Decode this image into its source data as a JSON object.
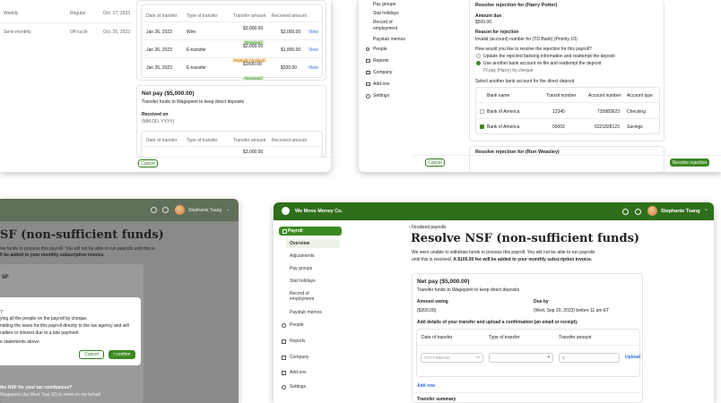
{
  "colors": {
    "brand_green": "#2f6f1c",
    "accent_green": "#3c8a22",
    "link_blue": "#2a6fdb"
  },
  "panel1": {
    "history_rows": [
      {
        "period": "Weekly",
        "type": "Regular",
        "date": "Oct. 17, 2023"
      },
      {
        "period": "Semi-monthly",
        "type": "Off-cycle",
        "date": "Oct. 25, 2023"
      }
    ],
    "transfer_headers": [
      "Date of transfer",
      "Type of transfer",
      "Transfer amount",
      "Received amount"
    ],
    "transfer_rows": [
      {
        "date": "Jan 26, 2023",
        "type": "Wire",
        "amount": "$3,000.00",
        "status": "Received",
        "received": "$3,000.00",
        "action": "View"
      },
      {
        "date": "Jan 26, 2023",
        "type": "E-transfer",
        "amount": "$2,000.00",
        "status": "Partially received",
        "received": "$1,800.00",
        "action": "View"
      },
      {
        "date": "Jan 26, 2023",
        "type": "E-transfer",
        "amount": "$1500.00",
        "status": "Received",
        "received": "$200.00",
        "action": "View"
      }
    ],
    "net_pay_title": "Net pay ($5,000.00)",
    "net_pay_sub": "Transfer funds to Wagepoint to keep direct deposits",
    "received_on_label": "Received on",
    "received_on_value": "(MM.DD, YYYY)",
    "second_amount": "$3,000.00",
    "cancel": "Cancel"
  },
  "panel2": {
    "sidebar": [
      "Pay groups",
      "Stat holidays",
      "Record of employment",
      "Paystub memos",
      "People",
      "Reports",
      "Company",
      "Add-ons",
      "Settings"
    ],
    "title": "Resolve rejection for (Harry Potter)",
    "amount_due_label": "Amount due",
    "amount_due_value": "$500.00",
    "reason_label": "Reason for rejection",
    "reason_value": "Invalid (account) number for (TD Bank) (Priority 10)",
    "question": "How would you like to resolve the rejection for this payroll?",
    "options": [
      "Update the rejected banking information and reattempt the deposit",
      "Use another bank account on file and reattempt the deposit",
      "I'll pay (Harry) by cheque"
    ],
    "select_label": "Select another bank account for the direct deposit",
    "bank_headers": [
      "Bank name",
      "Transit number",
      "Account number",
      "Account type"
    ],
    "banks": [
      {
        "name": "Bank of America",
        "transit": "12345",
        "account": "735883623",
        "type": "Checking"
      },
      {
        "name": "Bank of America",
        "transit": "55002",
        "account": "6321828123",
        "type": "Savings"
      }
    ],
    "second_title": "Resolve rejection for (Ron Weasley)",
    "cancel": "Cancel",
    "resolve": "Resolve rejection"
  },
  "panel3": {
    "user": "Stephanie Tsang",
    "title": "SF (non-sufficient funds)",
    "desc1": "ow funds to process this payroll. You will not be able to run payrolls until this is",
    "desc2": "ll be added to your monthly subscription invoice.",
    "card_title": "SF",
    "modal_lines": [
      "?",
      "ying all the people on the payroll by cheque.",
      "mitting the taxes for this payroll directly to the tax agency and will",
      "nalties or interest due to a late payment.",
      "e statements above."
    ],
    "cancel": "Cancel",
    "confirm": "I confirm",
    "footer1": "the NSF for your tax remittances?",
    "footer2": "Wagepoint (by Wed, Sep 22) to remit on my behalf"
  },
  "panel4": {
    "company": "We Move Money Co.",
    "user": "Stephanie Tsang",
    "sidebar": {
      "payroll": "Payroll",
      "subitems": [
        "Overview",
        "Adjustments",
        "Pay groups",
        "Stat holidays",
        "Record of employment",
        "Paystub memos"
      ],
      "items": [
        "People",
        "Reports",
        "Company",
        "Add-ons",
        "Settings"
      ]
    },
    "breadcrumb": "Finalized payrolls",
    "title": "Resolve NSF (non-sufficient funds)",
    "desc1": "We were unable to withdraw funds to process this payroll. You will not be able to run payrolls",
    "desc2_a": "until this is resolved. ",
    "desc2_b": "A $100.00 fee will be added to your monthly subscription invoice.",
    "card_title": "Net pay ($5,000.00)",
    "card_sub": "Transfer funds to Wagepoint to keep direct deposits",
    "amount_owing_label": "Amount owing",
    "amount_owing_value": "($200.00)",
    "due_by_label": "Due by",
    "due_by_value": "(Wed, Sep 20, 2023) before 11 am ET",
    "add_details": "Add details of your transfer and upload a confirmation (an email or receipt).",
    "col_headers": [
      "Date of transfer",
      "Type of transfer",
      "Transfer amount"
    ],
    "date_placeholder": "YYYY-MM-DD",
    "amount_placeholder": "$",
    "upload": "Upload",
    "add_row": "Add row",
    "summary": "Transfer summary"
  }
}
